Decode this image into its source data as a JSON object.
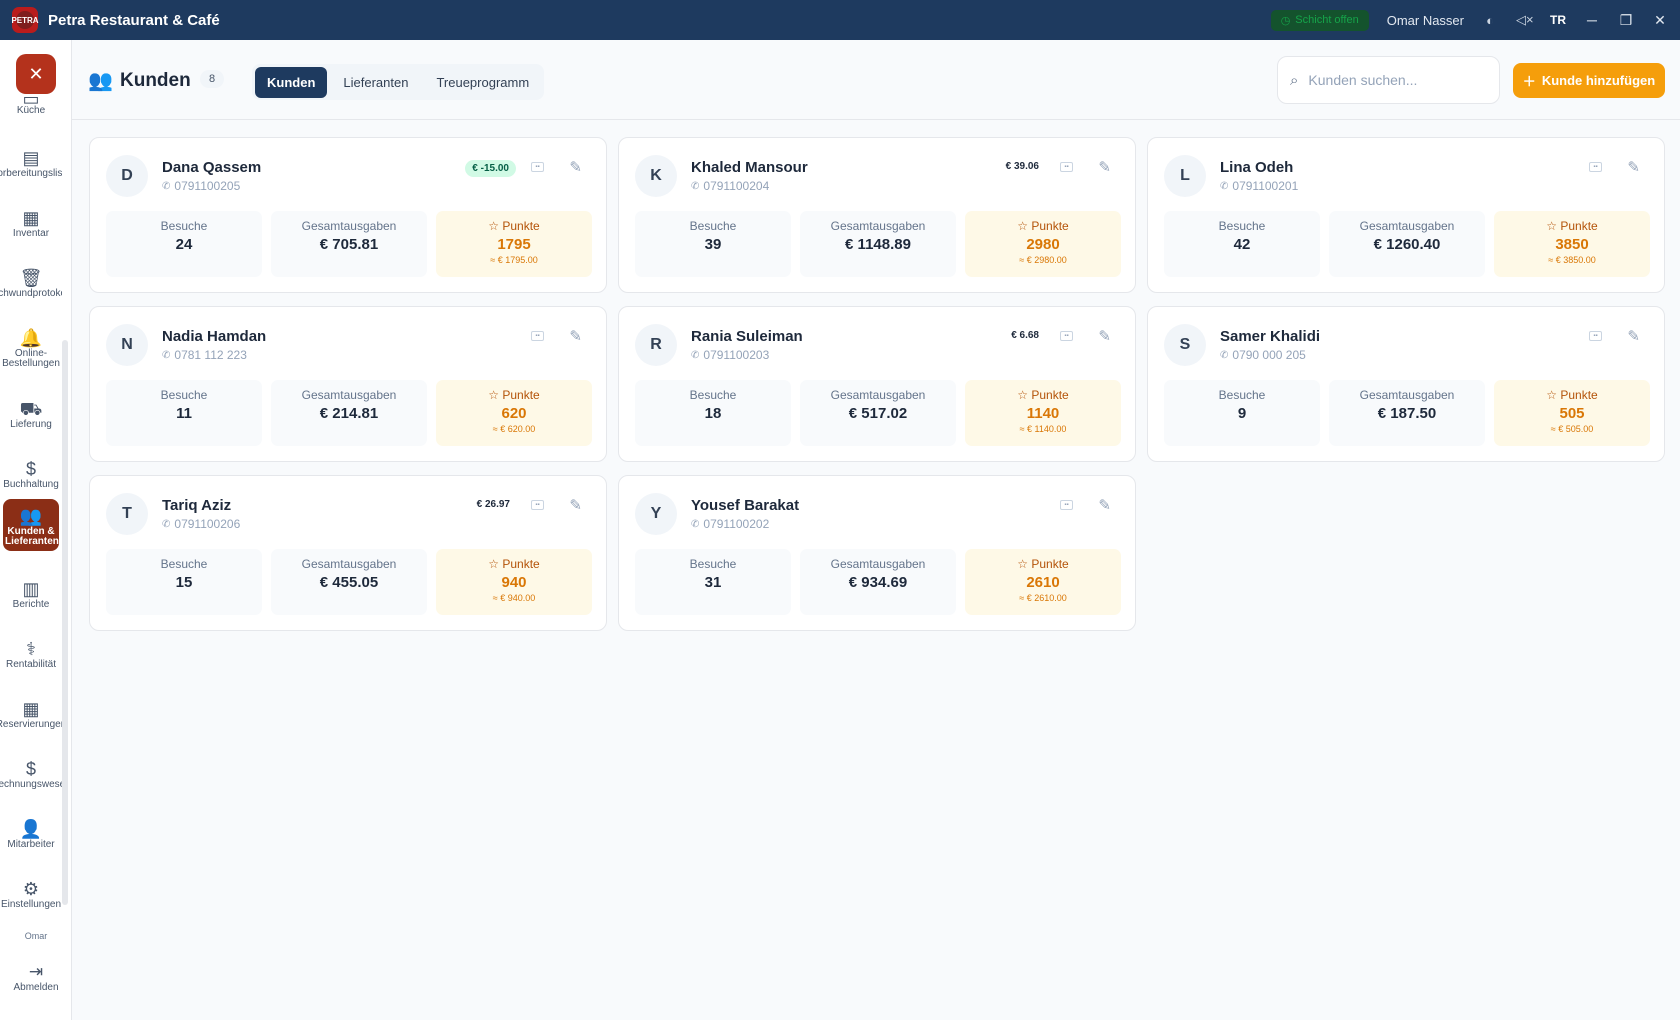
{
  "app": {
    "title": "Petra Restaurant & Café",
    "logo_text": "PETRA"
  },
  "titlebar": {
    "shift": "Schicht offen",
    "user": "Omar Nasser",
    "lang": "TR"
  },
  "sidebar": {
    "items": [
      {
        "label": "Küche",
        "icon": "chef-hat-icon"
      },
      {
        "label": "Vorbereitungsliste",
        "icon": "clipboard-icon"
      },
      {
        "label": "Inventar",
        "icon": "inventory-icon"
      },
      {
        "label": "Schwundprotokoll",
        "icon": "trash-icon"
      },
      {
        "label": "Online-Bestellungen",
        "icon": "bell-icon"
      },
      {
        "label": "Lieferung",
        "icon": "truck-icon"
      },
      {
        "label": "Buchhaltung",
        "icon": "dollar-icon"
      },
      {
        "label": "Kunden & Lieferanten",
        "icon": "users-icon"
      },
      {
        "label": "Berichte",
        "icon": "chart-icon"
      },
      {
        "label": "Rentabilität",
        "icon": "stethoscope-icon"
      },
      {
        "label": "Reservierungen",
        "icon": "calendar-icon"
      },
      {
        "label": "Rechnungswesen",
        "icon": "dollar-file-icon"
      },
      {
        "label": "Mitarbeiter",
        "icon": "staff-icon"
      },
      {
        "label": "Einstellungen",
        "icon": "gear-icon"
      }
    ],
    "user": "Omar",
    "logout": "Abmelden"
  },
  "header": {
    "title": "Kunden",
    "count": "8",
    "tabs": [
      "Kunden",
      "Lieferanten",
      "Treueprogramm"
    ],
    "search_placeholder": "Kunden suchen...",
    "add_label": "Kunde hinzufügen"
  },
  "labels": {
    "visits": "Besuche",
    "spend": "Gesamtausgaben",
    "points": "Punkte"
  },
  "customers": [
    {
      "initial": "D",
      "name": "Dana Qassem",
      "phone": "0791100205",
      "balance": "€ -15.00",
      "credit": true,
      "visits": "24",
      "spend": "€ 705.81",
      "points": "1795",
      "points_value": "≈ € 1795.00"
    },
    {
      "initial": "K",
      "name": "Khaled Mansour",
      "phone": "0791100204",
      "balance": "€ 39.06",
      "credit": false,
      "visits": "39",
      "spend": "€ 1148.89",
      "points": "2980",
      "points_value": "≈ € 2980.00"
    },
    {
      "initial": "L",
      "name": "Lina Odeh",
      "phone": "0791100201",
      "balance": "",
      "credit": false,
      "visits": "42",
      "spend": "€ 1260.40",
      "points": "3850",
      "points_value": "≈ € 3850.00"
    },
    {
      "initial": "N",
      "name": "Nadia Hamdan",
      "phone": "0781 112 223",
      "balance": "",
      "credit": false,
      "visits": "11",
      "spend": "€ 214.81",
      "points": "620",
      "points_value": "≈ € 620.00"
    },
    {
      "initial": "R",
      "name": "Rania Suleiman",
      "phone": "0791100203",
      "balance": "€ 6.68",
      "credit": false,
      "visits": "18",
      "spend": "€ 517.02",
      "points": "1140",
      "points_value": "≈ € 1140.00"
    },
    {
      "initial": "S",
      "name": "Samer Khalidi",
      "phone": "0790 000 205",
      "balance": "",
      "credit": false,
      "visits": "9",
      "spend": "€ 187.50",
      "points": "505",
      "points_value": "≈ € 505.00"
    },
    {
      "initial": "T",
      "name": "Tariq Aziz",
      "phone": "0791100206",
      "balance": "€ 26.97",
      "credit": false,
      "visits": "15",
      "spend": "€ 455.05",
      "points": "940",
      "points_value": "≈ € 940.00"
    },
    {
      "initial": "Y",
      "name": "Yousef Barakat",
      "phone": "0791100202",
      "balance": "",
      "credit": false,
      "visits": "31",
      "spend": "€ 934.69",
      "points": "2610",
      "points_value": "≈ € 2610.00"
    }
  ],
  "colors": {
    "titlebar": "#1e3a5f",
    "accent": "#f59e0b",
    "active_nav": "#8b2e16",
    "points_bg": "#fef9e7"
  }
}
